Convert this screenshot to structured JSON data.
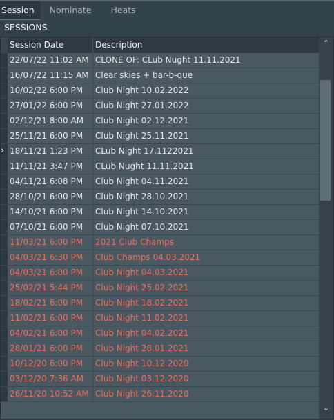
{
  "tabs": [
    "Session",
    "Nominate",
    "Heats"
  ],
  "section_title": "SESSIONS",
  "columns": [
    "Session Date",
    "Description"
  ],
  "selected_marker": "›",
  "colors": {
    "normal": "#e6e9eb",
    "past": "#e8705a"
  },
  "rows": [
    {
      "date": "22/07/22 11:02 AM",
      "desc": "CLONE OF: CLub Nught 11.11.2021",
      "past": false
    },
    {
      "date": "16/07/22 11:15 AM",
      "desc": "Clear skies + bar-b-que",
      "past": false
    },
    {
      "date": "10/02/22 6:00 PM",
      "desc": "Club Night 10.02.2022",
      "past": false
    },
    {
      "date": "27/01/22 6:00 PM",
      "desc": "Club Night 27.01.2022",
      "past": false
    },
    {
      "date": "02/12/21 8:00 AM",
      "desc": "Club Night 02.12.2021",
      "past": false
    },
    {
      "date": "25/11/21 6:00 PM",
      "desc": "Club Night 25.11.2021",
      "past": false
    },
    {
      "date": "18/11/21 1:23 PM",
      "desc": "CLub Night 17.1122021",
      "past": false,
      "selected": true
    },
    {
      "date": "11/11/21 3:47 PM",
      "desc": "CLub Nught 11.11.2021",
      "past": false
    },
    {
      "date": "04/11/21 6:08 PM",
      "desc": "Club Night 04.11.2021",
      "past": false
    },
    {
      "date": "28/10/21 6:00 PM",
      "desc": "Club Night 28.10.2021",
      "past": false
    },
    {
      "date": "14/10/21 6:00 PM",
      "desc": "Club Night 14.10.2021",
      "past": false
    },
    {
      "date": "07/10/21 6:00 PM",
      "desc": "Club Night 07.10.2021",
      "past": false
    },
    {
      "date": "11/03/21 6:00 PM",
      "desc": "2021 Club Champs",
      "past": true
    },
    {
      "date": "04/03/21 6:30 PM",
      "desc": "Club Champs 04.03.2021",
      "past": true
    },
    {
      "date": "04/03/21 6:00 PM",
      "desc": "Club Night 04.03.2021",
      "past": true
    },
    {
      "date": "25/02/21 5:44 PM",
      "desc": "Club Night 25.02.2021",
      "past": true
    },
    {
      "date": "18/02/21 6:00 PM",
      "desc": "Club Night 18.02.2021",
      "past": true
    },
    {
      "date": "11/02/21 6:00 PM",
      "desc": "Club Night 11.02.2021",
      "past": true
    },
    {
      "date": "04/02/21 6:00 PM",
      "desc": "Club Night 04.02.2021",
      "past": true
    },
    {
      "date": "28/01/21 6:00 PM",
      "desc": "Club Night 28.01.2021",
      "past": true
    },
    {
      "date": "10/12/20 6:00 PM",
      "desc": "Club Night 10.12.2020",
      "past": true
    },
    {
      "date": "03/12/20 7:36 AM",
      "desc": "Club Night 03.12.2020",
      "past": true
    },
    {
      "date": "26/11/20 10:52 AM",
      "desc": "Club Night 26.11.2020",
      "past": true
    }
  ]
}
